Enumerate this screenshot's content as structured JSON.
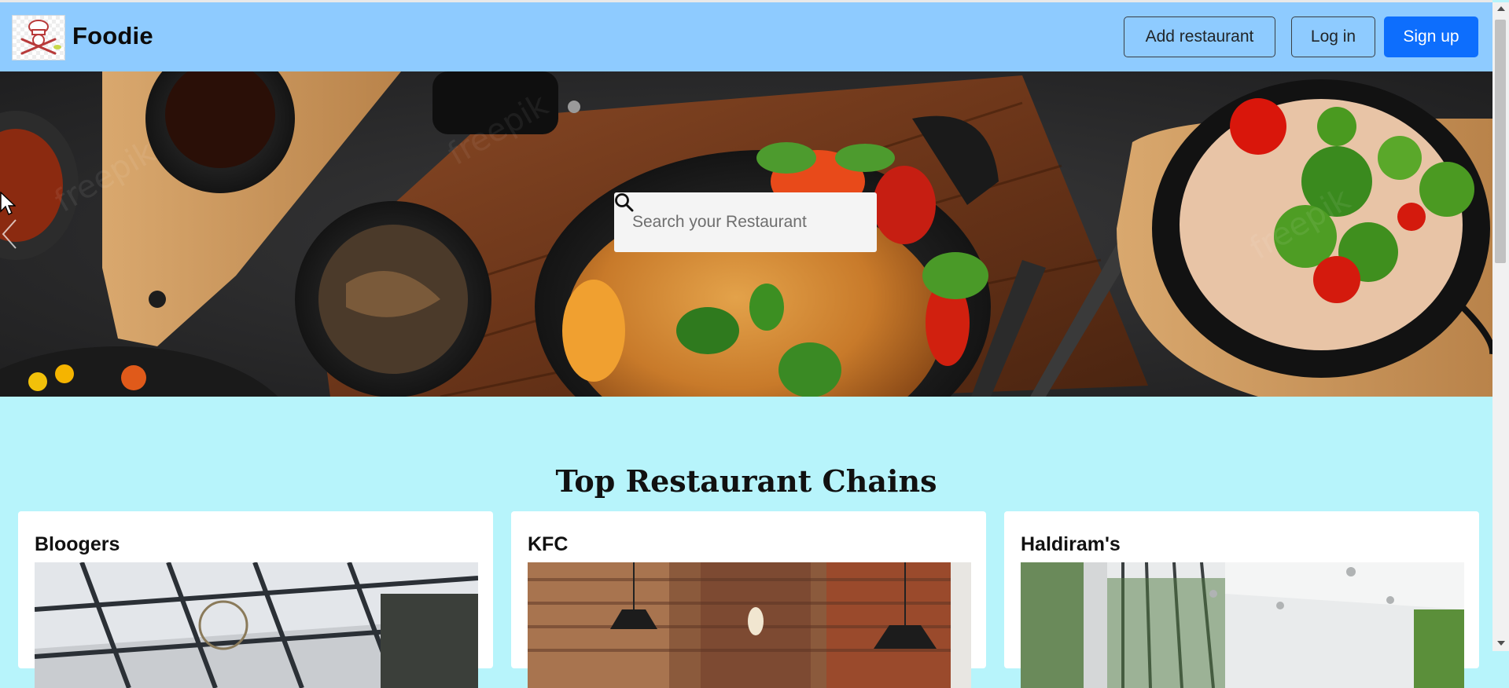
{
  "navbar": {
    "brand": "Foodie",
    "logo_icon": "chef-logo-icon",
    "add_restaurant_label": "Add restaurant",
    "login_label": "Log in",
    "signup_label": "Sign up",
    "colors": {
      "background": "#8ecbff",
      "primary": "#0d6efd"
    }
  },
  "hero": {
    "search": {
      "placeholder": "Search your Restaurant",
      "value": ""
    },
    "search_icon": "search-icon",
    "prev_icon": "chevron-left-icon"
  },
  "main": {
    "title": "Top Restaurant Chains",
    "background": "#b7f4fb",
    "cards": [
      {
        "name": "Bloogers"
      },
      {
        "name": "KFC"
      },
      {
        "name": "Haldiram's"
      }
    ]
  }
}
